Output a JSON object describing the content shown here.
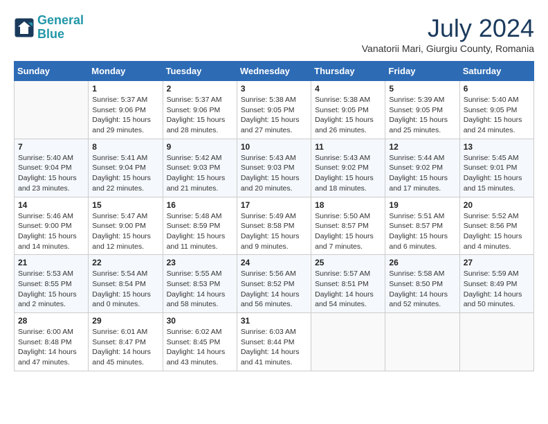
{
  "header": {
    "logo_line1": "General",
    "logo_line2": "Blue",
    "month_year": "July 2024",
    "location": "Vanatorii Mari, Giurgiu County, Romania"
  },
  "days_of_week": [
    "Sunday",
    "Monday",
    "Tuesday",
    "Wednesday",
    "Thursday",
    "Friday",
    "Saturday"
  ],
  "weeks": [
    [
      {
        "day": "",
        "info": ""
      },
      {
        "day": "1",
        "info": "Sunrise: 5:37 AM\nSunset: 9:06 PM\nDaylight: 15 hours\nand 29 minutes."
      },
      {
        "day": "2",
        "info": "Sunrise: 5:37 AM\nSunset: 9:06 PM\nDaylight: 15 hours\nand 28 minutes."
      },
      {
        "day": "3",
        "info": "Sunrise: 5:38 AM\nSunset: 9:05 PM\nDaylight: 15 hours\nand 27 minutes."
      },
      {
        "day": "4",
        "info": "Sunrise: 5:38 AM\nSunset: 9:05 PM\nDaylight: 15 hours\nand 26 minutes."
      },
      {
        "day": "5",
        "info": "Sunrise: 5:39 AM\nSunset: 9:05 PM\nDaylight: 15 hours\nand 25 minutes."
      },
      {
        "day": "6",
        "info": "Sunrise: 5:40 AM\nSunset: 9:05 PM\nDaylight: 15 hours\nand 24 minutes."
      }
    ],
    [
      {
        "day": "7",
        "info": "Sunrise: 5:40 AM\nSunset: 9:04 PM\nDaylight: 15 hours\nand 23 minutes."
      },
      {
        "day": "8",
        "info": "Sunrise: 5:41 AM\nSunset: 9:04 PM\nDaylight: 15 hours\nand 22 minutes."
      },
      {
        "day": "9",
        "info": "Sunrise: 5:42 AM\nSunset: 9:03 PM\nDaylight: 15 hours\nand 21 minutes."
      },
      {
        "day": "10",
        "info": "Sunrise: 5:43 AM\nSunset: 9:03 PM\nDaylight: 15 hours\nand 20 minutes."
      },
      {
        "day": "11",
        "info": "Sunrise: 5:43 AM\nSunset: 9:02 PM\nDaylight: 15 hours\nand 18 minutes."
      },
      {
        "day": "12",
        "info": "Sunrise: 5:44 AM\nSunset: 9:02 PM\nDaylight: 15 hours\nand 17 minutes."
      },
      {
        "day": "13",
        "info": "Sunrise: 5:45 AM\nSunset: 9:01 PM\nDaylight: 15 hours\nand 15 minutes."
      }
    ],
    [
      {
        "day": "14",
        "info": "Sunrise: 5:46 AM\nSunset: 9:00 PM\nDaylight: 15 hours\nand 14 minutes."
      },
      {
        "day": "15",
        "info": "Sunrise: 5:47 AM\nSunset: 9:00 PM\nDaylight: 15 hours\nand 12 minutes."
      },
      {
        "day": "16",
        "info": "Sunrise: 5:48 AM\nSunset: 8:59 PM\nDaylight: 15 hours\nand 11 minutes."
      },
      {
        "day": "17",
        "info": "Sunrise: 5:49 AM\nSunset: 8:58 PM\nDaylight: 15 hours\nand 9 minutes."
      },
      {
        "day": "18",
        "info": "Sunrise: 5:50 AM\nSunset: 8:57 PM\nDaylight: 15 hours\nand 7 minutes."
      },
      {
        "day": "19",
        "info": "Sunrise: 5:51 AM\nSunset: 8:57 PM\nDaylight: 15 hours\nand 6 minutes."
      },
      {
        "day": "20",
        "info": "Sunrise: 5:52 AM\nSunset: 8:56 PM\nDaylight: 15 hours\nand 4 minutes."
      }
    ],
    [
      {
        "day": "21",
        "info": "Sunrise: 5:53 AM\nSunset: 8:55 PM\nDaylight: 15 hours\nand 2 minutes."
      },
      {
        "day": "22",
        "info": "Sunrise: 5:54 AM\nSunset: 8:54 PM\nDaylight: 15 hours\nand 0 minutes."
      },
      {
        "day": "23",
        "info": "Sunrise: 5:55 AM\nSunset: 8:53 PM\nDaylight: 14 hours\nand 58 minutes."
      },
      {
        "day": "24",
        "info": "Sunrise: 5:56 AM\nSunset: 8:52 PM\nDaylight: 14 hours\nand 56 minutes."
      },
      {
        "day": "25",
        "info": "Sunrise: 5:57 AM\nSunset: 8:51 PM\nDaylight: 14 hours\nand 54 minutes."
      },
      {
        "day": "26",
        "info": "Sunrise: 5:58 AM\nSunset: 8:50 PM\nDaylight: 14 hours\nand 52 minutes."
      },
      {
        "day": "27",
        "info": "Sunrise: 5:59 AM\nSunset: 8:49 PM\nDaylight: 14 hours\nand 50 minutes."
      }
    ],
    [
      {
        "day": "28",
        "info": "Sunrise: 6:00 AM\nSunset: 8:48 PM\nDaylight: 14 hours\nand 47 minutes."
      },
      {
        "day": "29",
        "info": "Sunrise: 6:01 AM\nSunset: 8:47 PM\nDaylight: 14 hours\nand 45 minutes."
      },
      {
        "day": "30",
        "info": "Sunrise: 6:02 AM\nSunset: 8:45 PM\nDaylight: 14 hours\nand 43 minutes."
      },
      {
        "day": "31",
        "info": "Sunrise: 6:03 AM\nSunset: 8:44 PM\nDaylight: 14 hours\nand 41 minutes."
      },
      {
        "day": "",
        "info": ""
      },
      {
        "day": "",
        "info": ""
      },
      {
        "day": "",
        "info": ""
      }
    ]
  ]
}
